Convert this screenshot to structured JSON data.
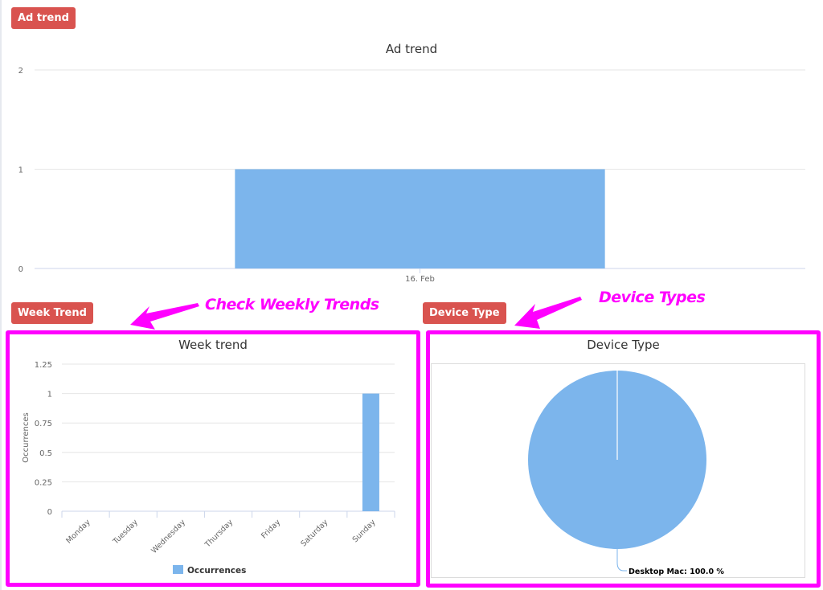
{
  "sections": {
    "ad_trend_label": "Ad trend",
    "week_trend_label": "Week Trend",
    "device_type_label": "Device Type"
  },
  "annotations": {
    "weekly": "Check Weekly Trends",
    "device": "Device Types",
    "color": "#ff00ff"
  },
  "colors": {
    "badge": "#d9534f",
    "series": "#7cb5ec",
    "grid": "#e6e6e6",
    "axis": "#ccd6eb"
  },
  "chart_data": [
    {
      "id": "ad-trend",
      "type": "bar",
      "title": "Ad trend",
      "categories": [
        "16. Feb"
      ],
      "values": [
        1
      ],
      "yticks": [
        "0",
        "1",
        "2"
      ],
      "ylim": [
        0,
        2
      ],
      "xlabel": "",
      "ylabel": "",
      "grid": true,
      "legend": false
    },
    {
      "id": "week-trend",
      "type": "bar",
      "title": "Week trend",
      "categories": [
        "Monday",
        "Tuesday",
        "Wednesday",
        "Thursday",
        "Friday",
        "Saturday",
        "Sunday"
      ],
      "series": [
        {
          "name": "Occurrences",
          "values": [
            0,
            0,
            0,
            0,
            0,
            0,
            1
          ]
        }
      ],
      "yticks": [
        "0",
        "0.25",
        "0.5",
        "0.75",
        "1",
        "1.25"
      ],
      "ylim": [
        0,
        1.25
      ],
      "xlabel": "",
      "ylabel": "Occurrences",
      "grid": true,
      "legend": "bottom-center"
    },
    {
      "id": "device-type",
      "type": "pie",
      "title": "Device Type",
      "slices": [
        {
          "label": "Desktop Mac",
          "value": 100.0
        }
      ],
      "data_labels": [
        "Desktop Mac: 100.0 %"
      ],
      "legend": false
    }
  ]
}
